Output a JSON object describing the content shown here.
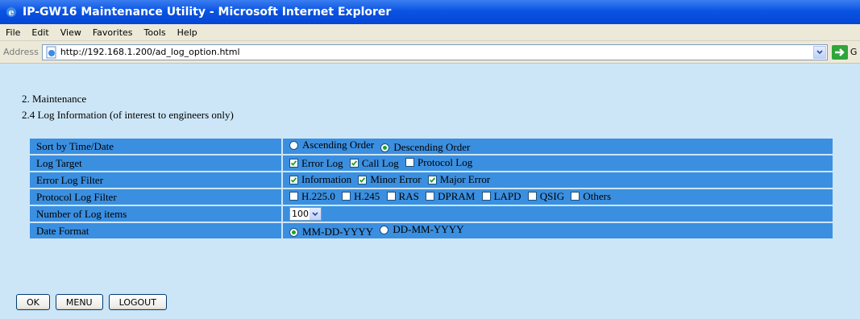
{
  "window": {
    "title": "IP-GW16 Maintenance Utility - Microsoft Internet Explorer"
  },
  "menu": [
    "File",
    "Edit",
    "View",
    "Favorites",
    "Tools",
    "Help"
  ],
  "address": {
    "label": "Address",
    "url": "http://192.168.1.200/ad_log_option.html",
    "go_label": "G"
  },
  "page": {
    "section": "2. Maintenance",
    "subsection": "2.4 Log Information (of interest to engineers only)"
  },
  "options": {
    "sort": {
      "label": "Sort by Time/Date",
      "choices": [
        {
          "text": "Ascending Order",
          "selected": false
        },
        {
          "text": "Descending Order",
          "selected": true
        }
      ]
    },
    "log_target": {
      "label": "Log Target",
      "choices": [
        {
          "text": "Error Log",
          "checked": true
        },
        {
          "text": "Call Log",
          "checked": true
        },
        {
          "text": "Protocol Log",
          "checked": false
        }
      ]
    },
    "error_filter": {
      "label": "Error Log Filter",
      "choices": [
        {
          "text": "Information",
          "checked": true
        },
        {
          "text": "Minor Error",
          "checked": true
        },
        {
          "text": "Major Error",
          "checked": true
        }
      ]
    },
    "protocol_filter": {
      "label": "Protocol Log Filter",
      "choices": [
        {
          "text": "H.225.0",
          "checked": false
        },
        {
          "text": "H.245",
          "checked": false
        },
        {
          "text": "RAS",
          "checked": false
        },
        {
          "text": "DPRAM",
          "checked": false
        },
        {
          "text": "LAPD",
          "checked": false
        },
        {
          "text": "QSIG",
          "checked": false
        },
        {
          "text": "Others",
          "checked": false
        }
      ]
    },
    "num_items": {
      "label": "Number of Log items",
      "value": "100"
    },
    "date_format": {
      "label": "Date Format",
      "choices": [
        {
          "text": "MM-DD-YYYY",
          "selected": true
        },
        {
          "text": "DD-MM-YYYY",
          "selected": false
        }
      ]
    }
  },
  "buttons": {
    "ok": "OK",
    "menu": "MENU",
    "logout": "LOGOUT"
  },
  "colors": {
    "content_bg": "#cce6f7",
    "row_bg": "#3b8fe0",
    "titlebar": "#0a54e3"
  }
}
